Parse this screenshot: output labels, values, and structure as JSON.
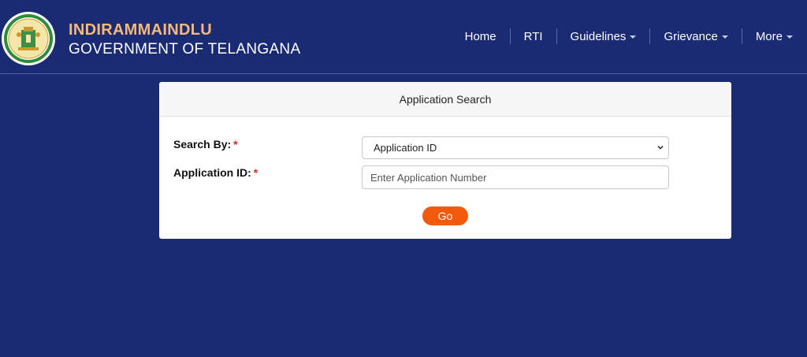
{
  "header": {
    "title": "INDIRAMMAINDLU",
    "subtitle": "GOVERNMENT OF TELANGANA",
    "logo_icon": "telangana-emblem-icon",
    "nav": [
      {
        "label": "Home",
        "has_dropdown": false
      },
      {
        "label": "RTI",
        "has_dropdown": false
      },
      {
        "label": "Guidelines",
        "has_dropdown": true
      },
      {
        "label": "Grievance",
        "has_dropdown": true
      },
      {
        "label": "More",
        "has_dropdown": true
      }
    ]
  },
  "search_card": {
    "title": "Application Search",
    "search_by_label": "Search By:",
    "search_by_required": "*",
    "search_by_value": "Application ID",
    "application_id_label": "Application ID:",
    "application_id_required": "*",
    "application_id_placeholder": "Enter Application Number",
    "application_id_value": "",
    "go_label": "Go"
  },
  "colors": {
    "page_background": "#1b2b73",
    "brand_title": "#f5b97a",
    "go_button": "#f15a0a",
    "required_mark": "#d9262b"
  }
}
